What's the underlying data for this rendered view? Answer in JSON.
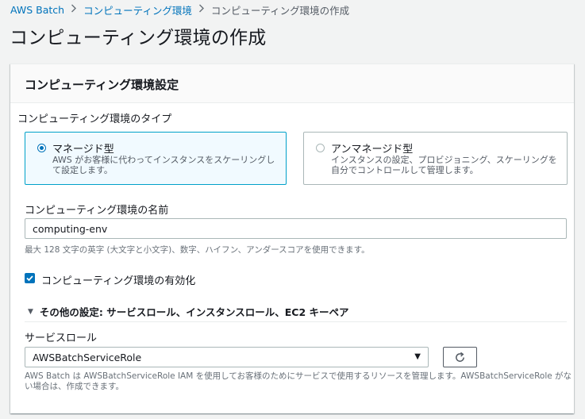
{
  "breadcrumb": {
    "items": [
      "AWS Batch",
      "コンピューティング環境",
      "コンピューティング環境の作成"
    ],
    "separator_icon": "chevron-right-icon"
  },
  "page": {
    "title": "コンピューティング環境の作成"
  },
  "panel": {
    "title": "コンピューティング環境設定",
    "env_type": {
      "label": "コンピューティング環境のタイプ",
      "options": [
        {
          "title": "マネージド型",
          "description": "AWS がお客様に代わってインスタンスをスケーリングして設定します。",
          "selected": true
        },
        {
          "title": "アンマネージド型",
          "description": "インスタンスの設定、プロビジョニング、スケーリングを自分でコントロールして管理します。",
          "selected": false
        }
      ]
    },
    "env_name": {
      "label": "コンピューティング環境の名前",
      "value": "computing-env",
      "hint": "最大 128 文字の英字 (大文字と小文字)、数字、ハイフン、アンダースコアを使用できます。"
    },
    "enable": {
      "label": "コンピューティング環境の有効化",
      "checked": true
    },
    "additional_settings": {
      "label": "その他の設定: サービスロール、インスタンスロール、EC2 キーペア",
      "expanded": true
    },
    "service_role": {
      "label": "サービスロール",
      "selected": "AWSBatchServiceRole",
      "refresh_icon": "refresh-icon",
      "hint": "AWS Batch は AWSBatchServiceRole IAM を使用してお客様のためにサービスで使用するリソースを管理します。AWSBatchServiceRole がない場合は、作成できます。"
    }
  },
  "colors": {
    "link": "#0073bb",
    "selected_border": "#00a1c9",
    "selected_bg": "#f1faff",
    "page_bg": "#f2f3f3"
  }
}
